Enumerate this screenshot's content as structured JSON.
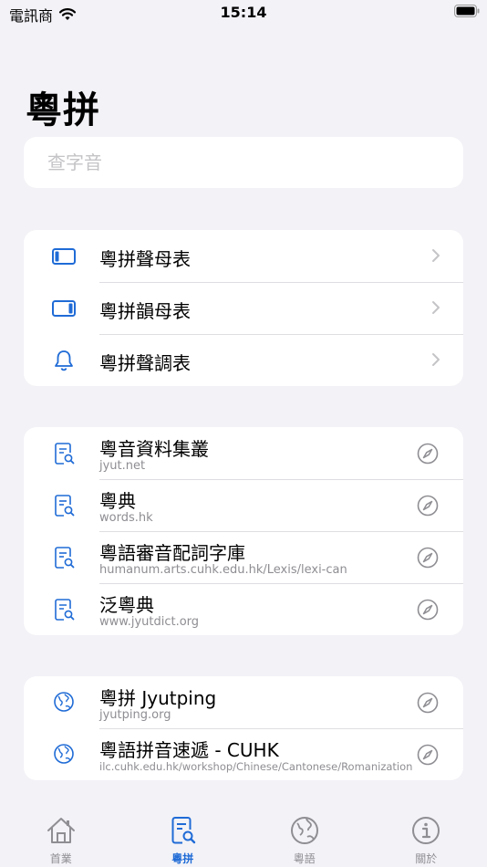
{
  "status": {
    "carrier": "電訊商",
    "time": "15:14"
  },
  "title": "粵拼",
  "search": {
    "placeholder": "查字音",
    "value": ""
  },
  "tables": [
    {
      "label": "粵拼聲母表",
      "icon": "sidebar-left-icon"
    },
    {
      "label": "粵拼韻母表",
      "icon": "sidebar-right-icon"
    },
    {
      "label": "粵拼聲調表",
      "icon": "bell-icon"
    }
  ],
  "dictionaries": [
    {
      "title": "粵音資料集叢",
      "url": "jyut.net"
    },
    {
      "title": "粵典",
      "url": "words.hk"
    },
    {
      "title": "粵語審音配詞字庫",
      "url": "humanum.arts.cuhk.edu.hk/Lexis/lexi-can"
    },
    {
      "title": "泛粵典",
      "url": "www.jyutdict.org"
    }
  ],
  "websites": [
    {
      "title": "粵拼 Jyutping",
      "url": "jyutping.org"
    },
    {
      "title": "粵語拼音速遞 - CUHK",
      "url": "ilc.cuhk.edu.hk/workshop/Chinese/Cantonese/Romanization"
    }
  ],
  "tabs": [
    {
      "label": "首業",
      "icon": "house-icon",
      "active": false
    },
    {
      "label": "粵拼",
      "icon": "doc-search-icon",
      "active": true
    },
    {
      "label": "粵語",
      "icon": "globe-icon",
      "active": false
    },
    {
      "label": "關於",
      "icon": "info-icon",
      "active": false
    }
  ],
  "colors": {
    "accent": "#1f6bd6",
    "secondary_text": "#8e8e93",
    "background": "#f2f2f7"
  }
}
